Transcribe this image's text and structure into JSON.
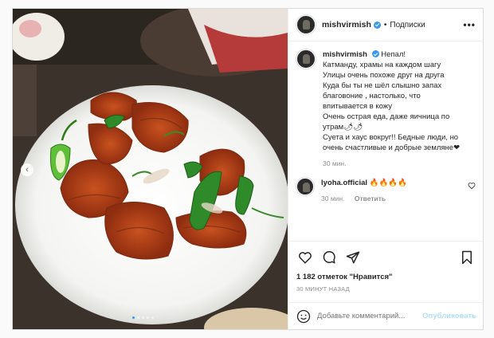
{
  "post": {
    "username": "mishvirmish",
    "separator": "•",
    "follow_label": "Подписки",
    "more_label": "•••"
  },
  "caption": {
    "username": "mishvirmish",
    "lines": [
      "Непал!",
      "Катманду, храмы на каждом шагу",
      "Улицы очень похоже друг на друга",
      "Куда бы ты не шёл слышно запах",
      "благовоние , настолько, что",
      "впитывается в кожу",
      "Очень острая еда, даже яичница по",
      "утрам🌶🌶",
      "Суета и хаус вокруг!! Бедные люди, но",
      "очень счастливые и добрые земляне❤"
    ],
    "time": "30 мин."
  },
  "reply": {
    "username": "lyoha.official",
    "text": "🔥🔥🔥🔥",
    "time": "30 мин.",
    "reply_label": "Ответить"
  },
  "stats": {
    "likes": "1 182 отметок \"Нравится\"",
    "ago": "30 МИНУТ НАЗАД"
  },
  "add_comment": {
    "placeholder": "Добавьте комментарий...",
    "publish_label": "Опубликовать"
  },
  "carousel": {
    "prev_label": "‹",
    "dots_total": 5,
    "active_dot": 0
  },
  "colors": {
    "verified": "#3897f0",
    "muted": "#8e8e8e",
    "publish_disabled": "#b2dffc"
  },
  "icons": [
    "heart-icon",
    "comment-icon",
    "share-icon",
    "bookmark-icon",
    "emoji-icon",
    "more-icon",
    "verified-icon"
  ]
}
